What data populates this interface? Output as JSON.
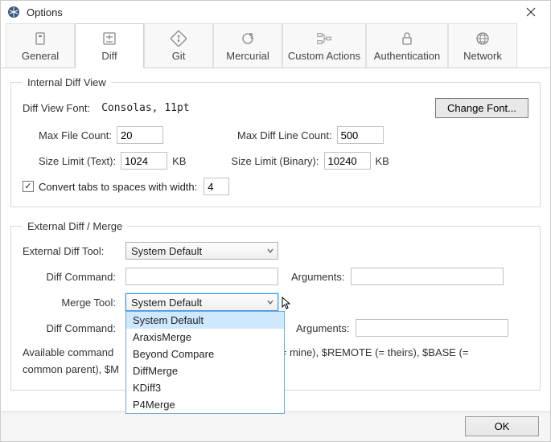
{
  "window": {
    "title": "Options"
  },
  "tabs": {
    "general": "General",
    "diff": "Diff",
    "git": "Git",
    "mercurial": "Mercurial",
    "custom": "Custom Actions",
    "auth": "Authentication",
    "network": "Network"
  },
  "internal": {
    "legend": "Internal Diff View",
    "font_label": "Diff View Font:",
    "font_value": "Consolas, 11pt",
    "change_font": "Change Font...",
    "max_file_count_label": "Max File Count:",
    "max_file_count": "20",
    "max_diff_line_label": "Max Diff Line Count:",
    "max_diff_line": "500",
    "size_limit_text_label": "Size Limit (Text):",
    "size_limit_text": "1024",
    "kb": "KB",
    "size_limit_binary_label": "Size Limit (Binary):",
    "size_limit_binary": "10240",
    "convert_tabs_label": "Convert tabs to spaces with width:",
    "convert_tabs_width": "4"
  },
  "external": {
    "legend": "External Diff / Merge",
    "diff_tool_label": "External Diff Tool:",
    "diff_tool_value": "System Default",
    "diff_command_label": "Diff Command:",
    "diff_command": "",
    "arguments_label": "Arguments:",
    "diff_arguments": "",
    "merge_tool_label": "Merge Tool:",
    "merge_tool_value": "System Default",
    "merge_command_label": "Diff Command:",
    "merge_command": "",
    "merge_arguments": "",
    "hint": "Available command line substitutions: $LOCAL (= mine), $REMOTE (= theirs), $BASE (= common parent), $MERGED (merged result)",
    "hint_visible_part1": "Available command",
    "hint_visible_part2": "(= mine), $REMOTE (= theirs), $BASE (=",
    "hint_visible_part3": "common parent), $M",
    "options": [
      "System Default",
      "AraxisMerge",
      "Beyond Compare",
      "DiffMerge",
      "KDiff3",
      "P4Merge"
    ]
  },
  "footer": {
    "ok": "OK"
  }
}
